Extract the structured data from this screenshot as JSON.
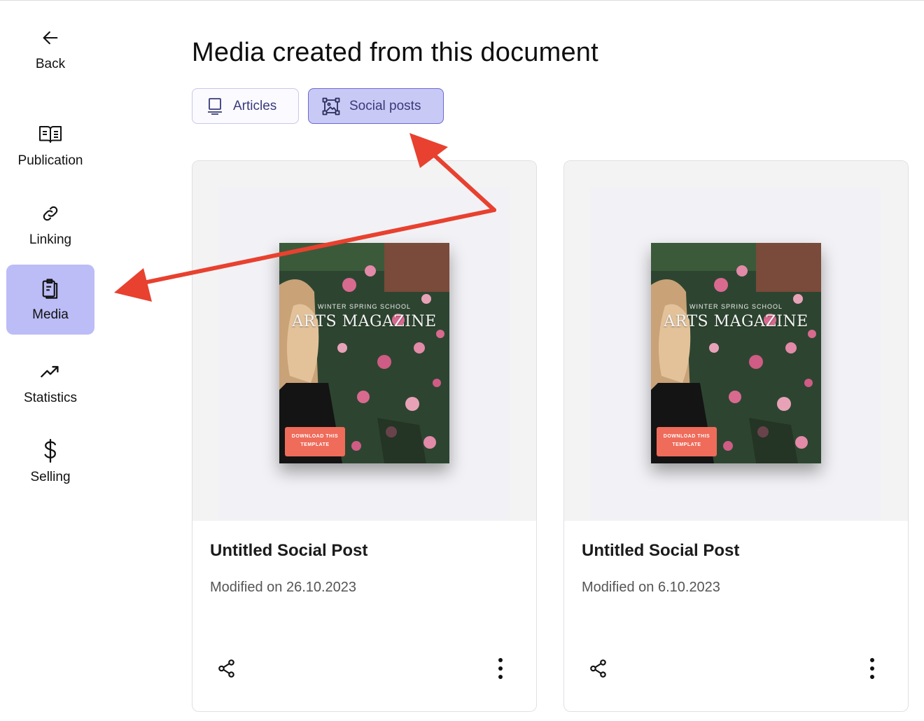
{
  "sidebar": {
    "items": [
      {
        "label": "Back",
        "icon": "arrow-left-icon"
      },
      {
        "label": "Publication",
        "icon": "open-book-icon"
      },
      {
        "label": "Linking",
        "icon": "link-icon"
      },
      {
        "label": "Media",
        "icon": "clipboard-copy-icon",
        "active": true
      },
      {
        "label": "Statistics",
        "icon": "trending-up-icon"
      },
      {
        "label": "Selling",
        "icon": "dollar-icon"
      }
    ]
  },
  "main": {
    "title": "Media created from this document",
    "tabs": [
      {
        "label": "Articles",
        "icon": "laptop-icon"
      },
      {
        "label": "Social posts",
        "icon": "image-frame-icon",
        "active": true
      }
    ],
    "cards": [
      {
        "title": "Untitled Social Post",
        "meta": "Modified on 26.10.2023",
        "thumbnail": {
          "kicker": "WINTER SPRING SCHOOL",
          "headline": "ARTS MAGAZINE",
          "cta": "DOWNLOAD THIS TEMPLATE"
        }
      },
      {
        "title": "Untitled Social Post",
        "meta": "Modified on 6.10.2023",
        "thumbnail": {
          "kicker": "WINTER SPRING SCHOOL",
          "headline": "ARTS MAGAZINE",
          "cta": "DOWNLOAD THIS TEMPLATE"
        }
      }
    ]
  },
  "colors": {
    "active_nav": "#bcbcf7",
    "active_tab": "#c9c9f6",
    "annotation_arrow": "#e8412f"
  }
}
